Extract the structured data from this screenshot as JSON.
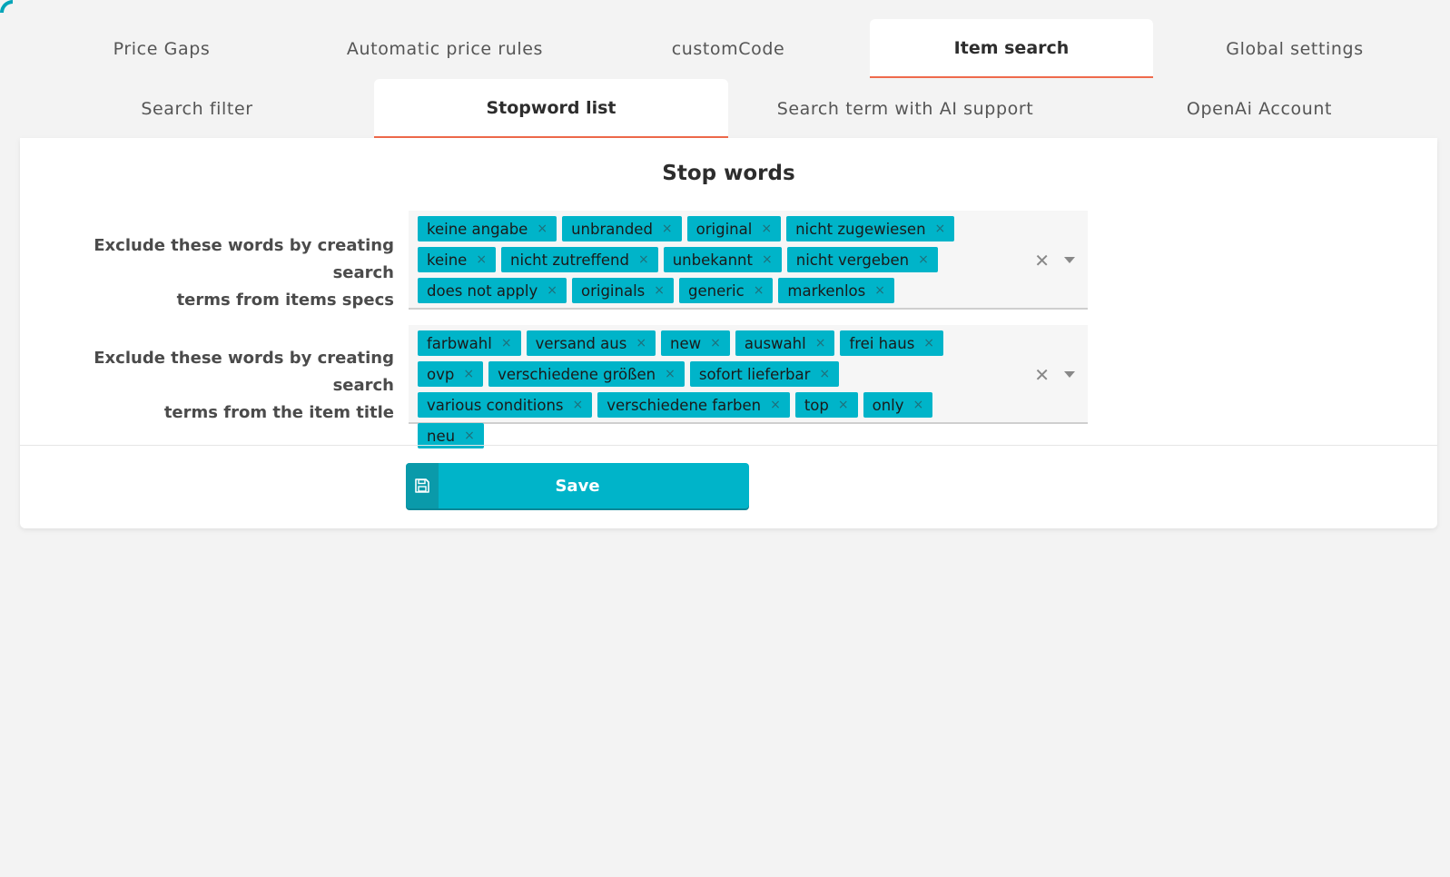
{
  "tabs_row1": [
    {
      "label": "Price Gaps",
      "active": false
    },
    {
      "label": "Automatic price rules",
      "active": false
    },
    {
      "label": "customCode",
      "active": false
    },
    {
      "label": "Item search",
      "active": true
    },
    {
      "label": "Global settings",
      "active": false
    }
  ],
  "tabs_row2": [
    {
      "label": "Search filter",
      "active": false
    },
    {
      "label": "Stopword list",
      "active": true
    },
    {
      "label": "Search term with AI support",
      "active": false
    },
    {
      "label": "OpenAi Account",
      "active": false
    }
  ],
  "panel": {
    "title": "Stop words",
    "fields": [
      {
        "label_line1": "Exclude these words by creating search",
        "label_line2": "terms from items specs",
        "tags": [
          "keine angabe",
          "unbranded",
          "original",
          "nicht zugewiesen",
          "keine",
          "nicht zutreffend",
          "unbekannt",
          "nicht vergeben",
          "does not apply",
          "originals",
          "generic",
          "markenlos"
        ]
      },
      {
        "label_line1": "Exclude these words by creating search",
        "label_line2": "terms from the item title",
        "tags": [
          "farbwahl",
          "versand aus",
          "new",
          "auswahl",
          "frei haus",
          "ovp",
          "verschiedene größen",
          "sofort lieferbar",
          "various conditions",
          "verschiedene farben",
          "top",
          "only",
          "neu"
        ]
      }
    ],
    "tag_remove_glyph": "×",
    "clear_glyph": "✕",
    "save_label": "Save"
  },
  "colors": {
    "accent": "#00b4c9",
    "active_tab_underline": "#ef6a4c",
    "background": "#f3f3f3"
  },
  "icons": {
    "save": "floppy-disk-icon",
    "clear": "clear-icon",
    "dropdown": "chevron-down-icon"
  }
}
